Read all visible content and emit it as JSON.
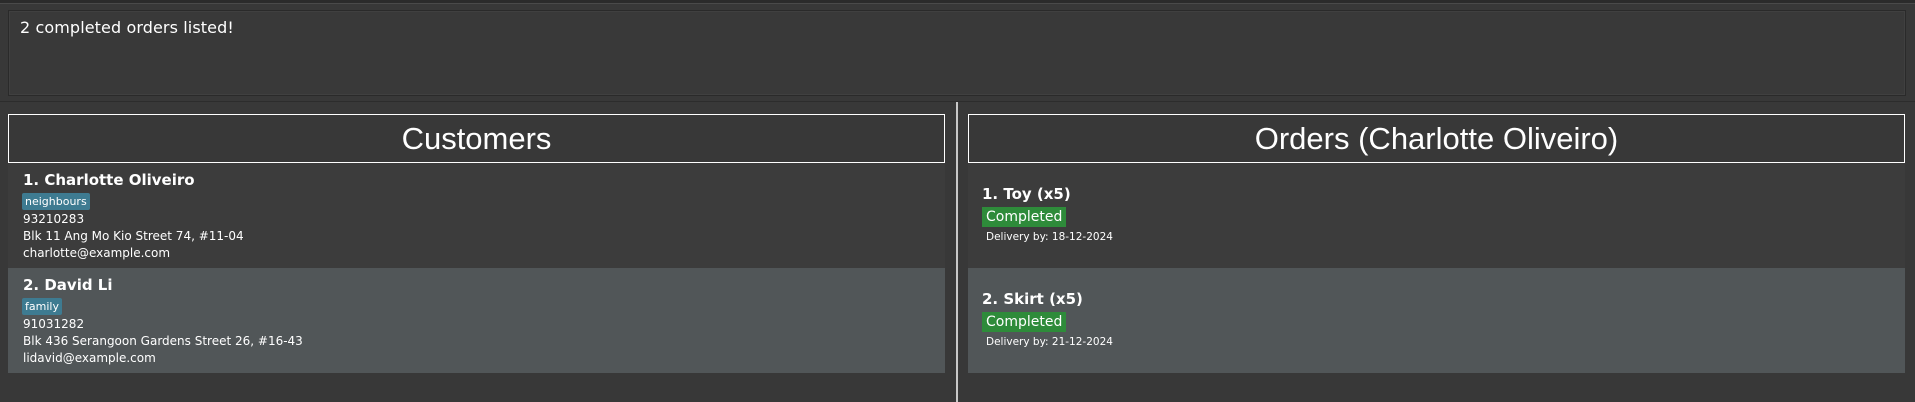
{
  "result": {
    "message": "2 completed orders listed!"
  },
  "customers": {
    "title": "Customers",
    "items": [
      {
        "name": "1. Charlotte Oliveiro",
        "tag": "neighbours",
        "phone": "93210283",
        "address": "Blk 11 Ang Mo Kio Street 74, #11-04",
        "email": "charlotte@example.com"
      },
      {
        "name": "2. David Li",
        "tag": "family",
        "phone": "91031282",
        "address": "Blk 436 Serangoon Gardens Street 26, #16-43",
        "email": "lidavid@example.com"
      }
    ]
  },
  "orders": {
    "title": "Orders (Charlotte Oliveiro)",
    "items": [
      {
        "name": "1. Toy (x5)",
        "status": "Completed",
        "delivery": "Delivery by: 18-12-2024"
      },
      {
        "name": "2. Skirt (x5)",
        "status": "Completed",
        "delivery": "Delivery by: 21-12-2024"
      }
    ]
  },
  "colors": {
    "background": "#383838",
    "tag": "#3e7b91",
    "status_completed": "#2e8b3a",
    "card_alt": "#515658"
  }
}
